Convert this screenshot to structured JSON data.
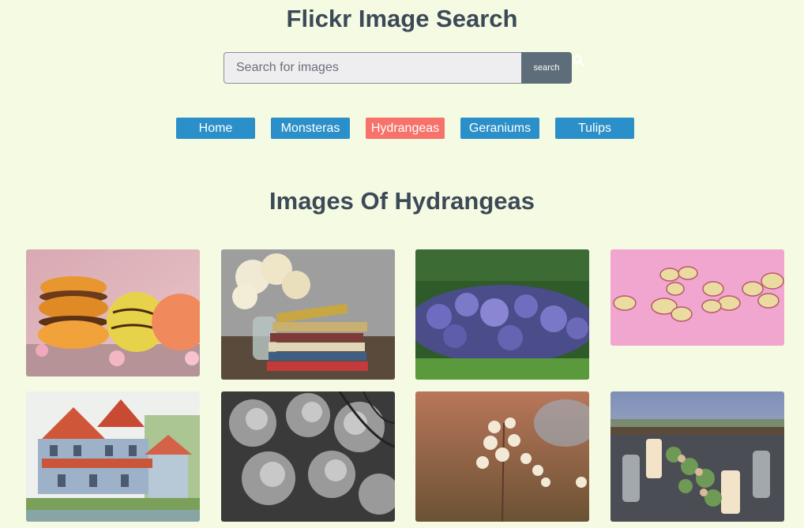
{
  "header": {
    "title": "Flickr Image Search"
  },
  "search": {
    "placeholder": "Search for images",
    "value": "",
    "button_label": "search"
  },
  "nav": {
    "items": [
      {
        "label": "Home",
        "active": false
      },
      {
        "label": "Monsteras",
        "active": false
      },
      {
        "label": "Hydrangeas",
        "active": true
      },
      {
        "label": "Geraniums",
        "active": false
      },
      {
        "label": "Tulips",
        "active": false
      }
    ]
  },
  "gallery": {
    "heading": "Images Of Hydrangeas",
    "images": [
      {
        "alt": "macarons with hydrangea petals"
      },
      {
        "alt": "hydrangeas in vase with books"
      },
      {
        "alt": "purple hydrangea hedge"
      },
      {
        "alt": "pink hydrangea florets"
      },
      {
        "alt": "painted victorian house"
      },
      {
        "alt": "black and white hydrangea"
      },
      {
        "alt": "autumn hydrangea bloom"
      },
      {
        "alt": "table setting with candles"
      }
    ]
  },
  "colors": {
    "background": "#f5fae3",
    "nav_button": "#2b8fc9",
    "nav_button_active": "#f6726a",
    "search_button": "#5d6d7a",
    "text": "#3c4a57"
  }
}
